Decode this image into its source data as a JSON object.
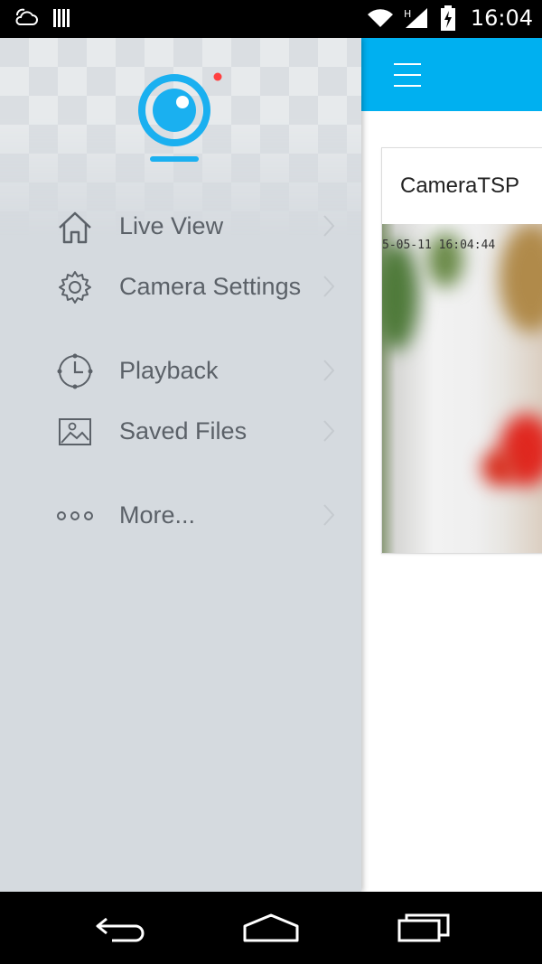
{
  "status_bar": {
    "time": "16:04",
    "icons": [
      "weather-cloud-icon",
      "barcode-icon",
      "wifi-icon",
      "signal-icon",
      "battery-charging-icon"
    ]
  },
  "camera_card": {
    "title": "CameraTSP",
    "timestamp": "5-05-11 16:04:44"
  },
  "drawer": {
    "notification_dot_color": "#ff4040",
    "accent_color": "#1ab0f0",
    "items": [
      {
        "label": "Live View",
        "icon": "home-icon"
      },
      {
        "label": "Camera Settings",
        "icon": "gear-icon"
      },
      {
        "label": "Playback",
        "icon": "clock-icon"
      },
      {
        "label": "Saved Files",
        "icon": "image-icon"
      },
      {
        "label": "More...",
        "icon": "more-dots-icon"
      }
    ]
  },
  "app_bar": {
    "color": "#00b0f0",
    "menu_icon": "hamburger-icon"
  },
  "nav_bar": {
    "buttons": [
      "back-icon",
      "home-icon",
      "recents-icon"
    ]
  }
}
